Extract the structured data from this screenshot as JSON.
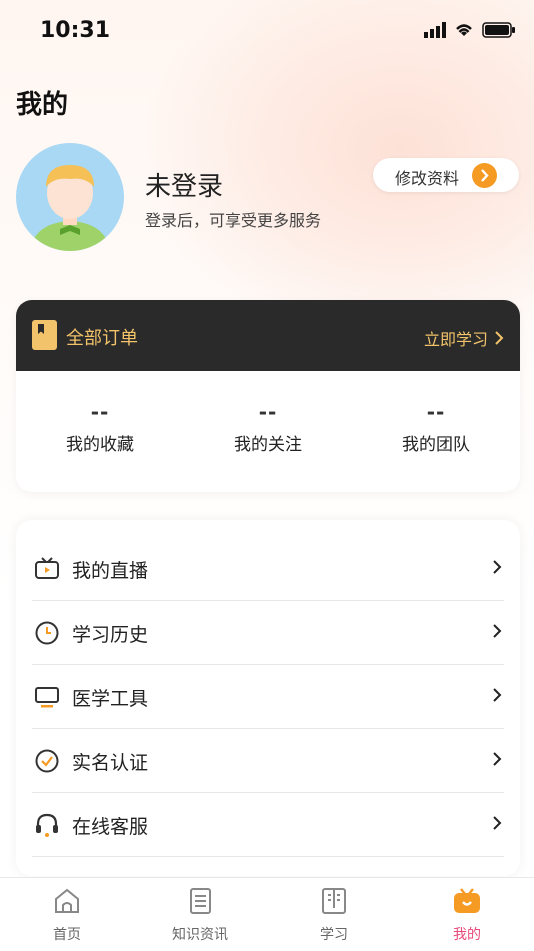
{
  "status": {
    "time": "10:31"
  },
  "page": {
    "title": "我的"
  },
  "profile": {
    "name": "未登录",
    "subtitle": "登录后，可享受更多服务",
    "edit_label": "修改资料"
  },
  "orders": {
    "label": "全部订单",
    "link_label": "立即学习",
    "stats": [
      {
        "value": "--",
        "label": "我的收藏"
      },
      {
        "value": "--",
        "label": "我的关注"
      },
      {
        "value": "--",
        "label": "我的团队"
      }
    ]
  },
  "menu": [
    {
      "label": "我的直播",
      "icon": "tv-icon"
    },
    {
      "label": "学习历史",
      "icon": "clock-icon"
    },
    {
      "label": "医学工具",
      "icon": "monitor-icon"
    },
    {
      "label": "实名认证",
      "icon": "check-circle-icon"
    },
    {
      "label": "在线客服",
      "icon": "headset-icon"
    }
  ],
  "tabs": [
    {
      "label": "首页",
      "icon": "home-icon"
    },
    {
      "label": "知识资讯",
      "icon": "document-icon"
    },
    {
      "label": "学习",
      "icon": "book-icon"
    },
    {
      "label": "我的",
      "icon": "tv-face-icon",
      "active": true
    }
  ],
  "colors": {
    "accent": "#f59a23",
    "gold": "#f2c36a",
    "active_tab": "#e94a7a"
  }
}
